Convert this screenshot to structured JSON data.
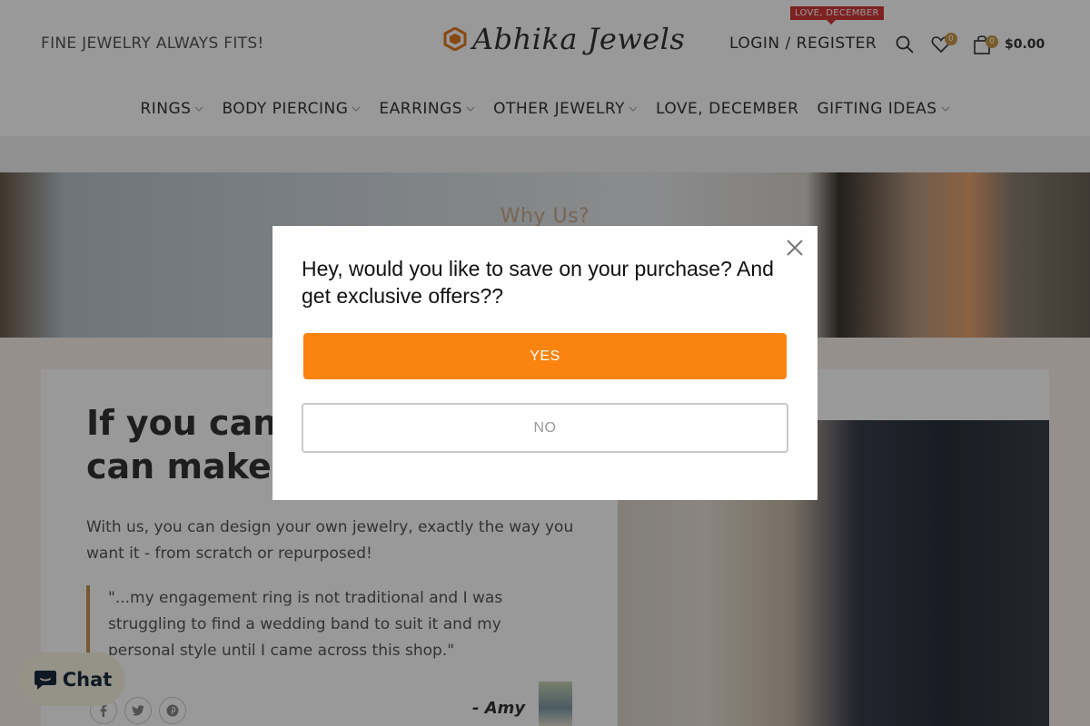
{
  "header": {
    "tagline": "FINE JEWELRY ALWAYS FITS!",
    "logo_text": "Abhika Jewels",
    "login_label": "LOGIN / REGISTER",
    "promo_badge": "LOVE, DECEMBER",
    "wishlist_count": "0",
    "cart_count": "0",
    "cart_total": "$0.00",
    "accent_color": "#c99a4a"
  },
  "nav": {
    "items": [
      {
        "label": "RINGS",
        "has_dropdown": true
      },
      {
        "label": "BODY PIERCING",
        "has_dropdown": true
      },
      {
        "label": "EARRINGS",
        "has_dropdown": true
      },
      {
        "label": "OTHER JEWELRY",
        "has_dropdown": true
      },
      {
        "label": "LOVE, DECEMBER",
        "has_dropdown": false
      },
      {
        "label": "GIFTING IDEAS",
        "has_dropdown": true
      }
    ]
  },
  "hero": {
    "title": "Why Us?"
  },
  "main": {
    "heading_line1": "If you can t",
    "heading_line2": "can make i",
    "intro": "With us, you can design your own jewelry, exactly the way you want it - from scratch or repurposed!",
    "quote": "\"...my engagement ring is not traditional and I was struggling to find a wedding band to suit it and my personal style until I came across this shop.\"",
    "author": "- Amy",
    "socials": [
      "facebook-icon",
      "twitter-icon",
      "pinterest-icon"
    ]
  },
  "chat": {
    "label": "Chat"
  },
  "modal": {
    "message": "Hey, would you like to save on your purchase? And get exclusive offers??",
    "yes_label": "YES",
    "no_label": "NO",
    "yes_color": "#fb830f"
  }
}
